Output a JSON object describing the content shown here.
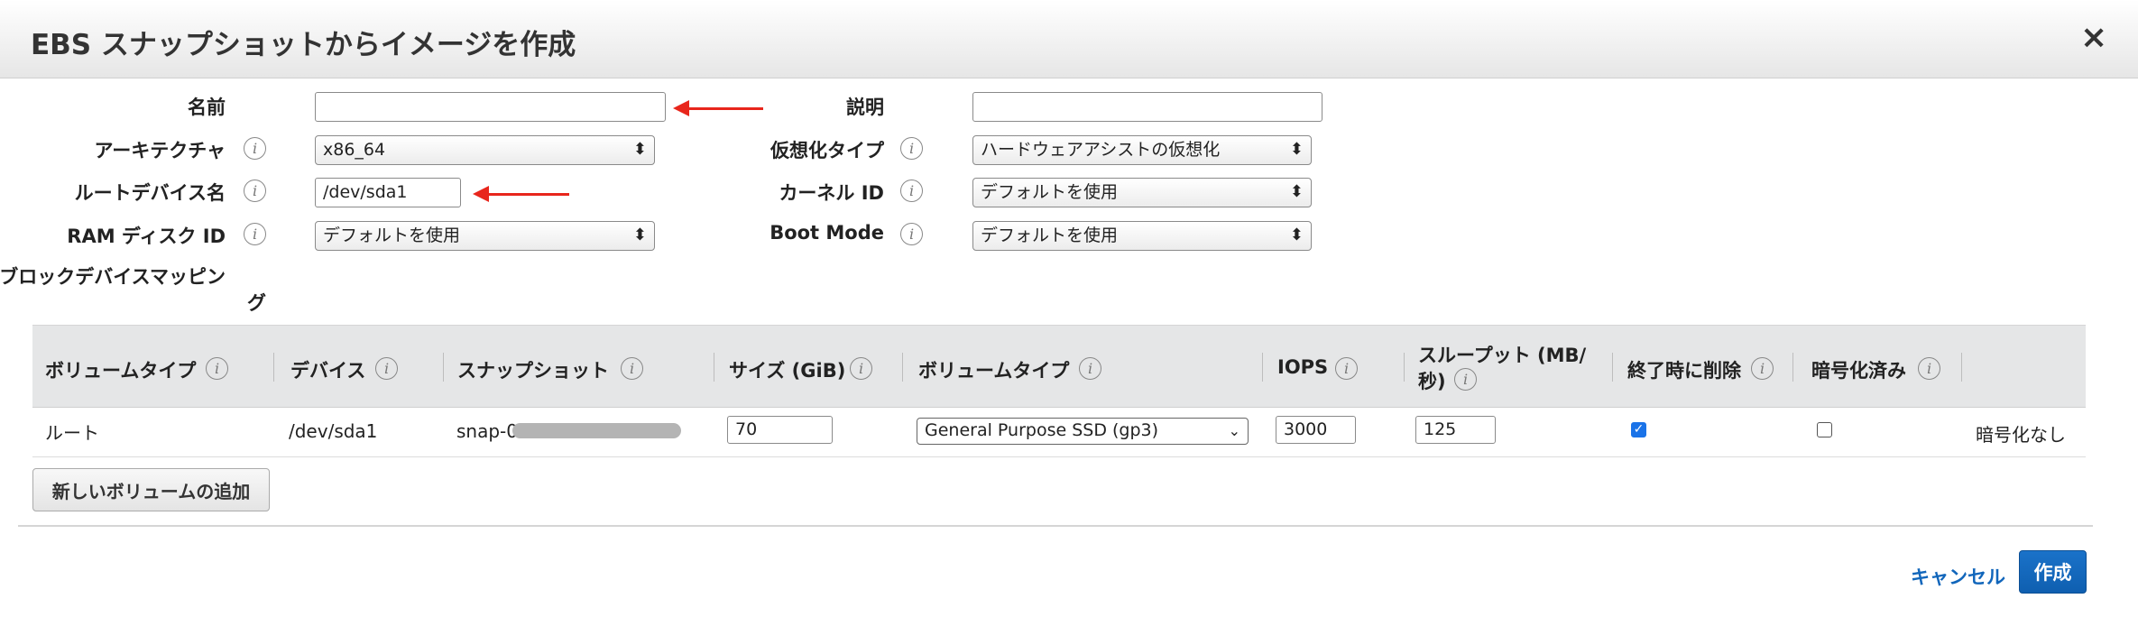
{
  "dialog": {
    "title": "EBS スナップショットからイメージを作成",
    "close_glyph": "×"
  },
  "form": {
    "name": {
      "label": "名前",
      "value": ""
    },
    "description": {
      "label": "説明",
      "value": ""
    },
    "architecture": {
      "label": "アーキテクチャ",
      "value": "x86_64"
    },
    "virtualization": {
      "label": "仮想化タイプ",
      "value": "ハードウェアアシストの仮想化"
    },
    "root_device": {
      "label": "ルートデバイス名",
      "value": "/dev/sda1"
    },
    "kernel_id": {
      "label": "カーネル ID",
      "value": "デフォルトを使用"
    },
    "ramdisk_id": {
      "label": "RAM ディスク ID",
      "value": "デフォルトを使用"
    },
    "boot_mode": {
      "label": "Boot Mode",
      "value": "デフォルトを使用"
    },
    "block_device_mapping": {
      "label_line1": "ブロックデバイスマッピン",
      "label_line2": "グ"
    }
  },
  "table": {
    "headers": {
      "volume_type": "ボリュームタイプ",
      "device": "デバイス",
      "snapshot": "スナップショット",
      "size": "サイズ (GiB)",
      "volume_type2": "ボリュームタイプ",
      "iops": "IOPS",
      "throughput_line1": "スループット (MB/",
      "throughput_line2": "秒)",
      "delete_on_termination": "終了時に削除",
      "encrypted": "暗号化済み"
    },
    "row": {
      "volume_type": "ルート",
      "device": "/dev/sda1",
      "snapshot": "snap-0",
      "size": "70",
      "volume_type_select": "General Purpose SSD (gp3)",
      "iops": "3000",
      "throughput": "125",
      "delete_on_termination": true,
      "encrypted": false,
      "encryption_status": "暗号化なし"
    },
    "add_volume_button": "新しいボリュームの追加"
  },
  "footer": {
    "cancel": "キャンセル",
    "create": "作成"
  },
  "icons": {
    "info": "i",
    "select_arrow": "⬍",
    "checkmark": "✓"
  },
  "colors": {
    "accent": "#1166bb",
    "primary_button": "#1a72c9",
    "annotation_arrow": "#e8261c"
  }
}
